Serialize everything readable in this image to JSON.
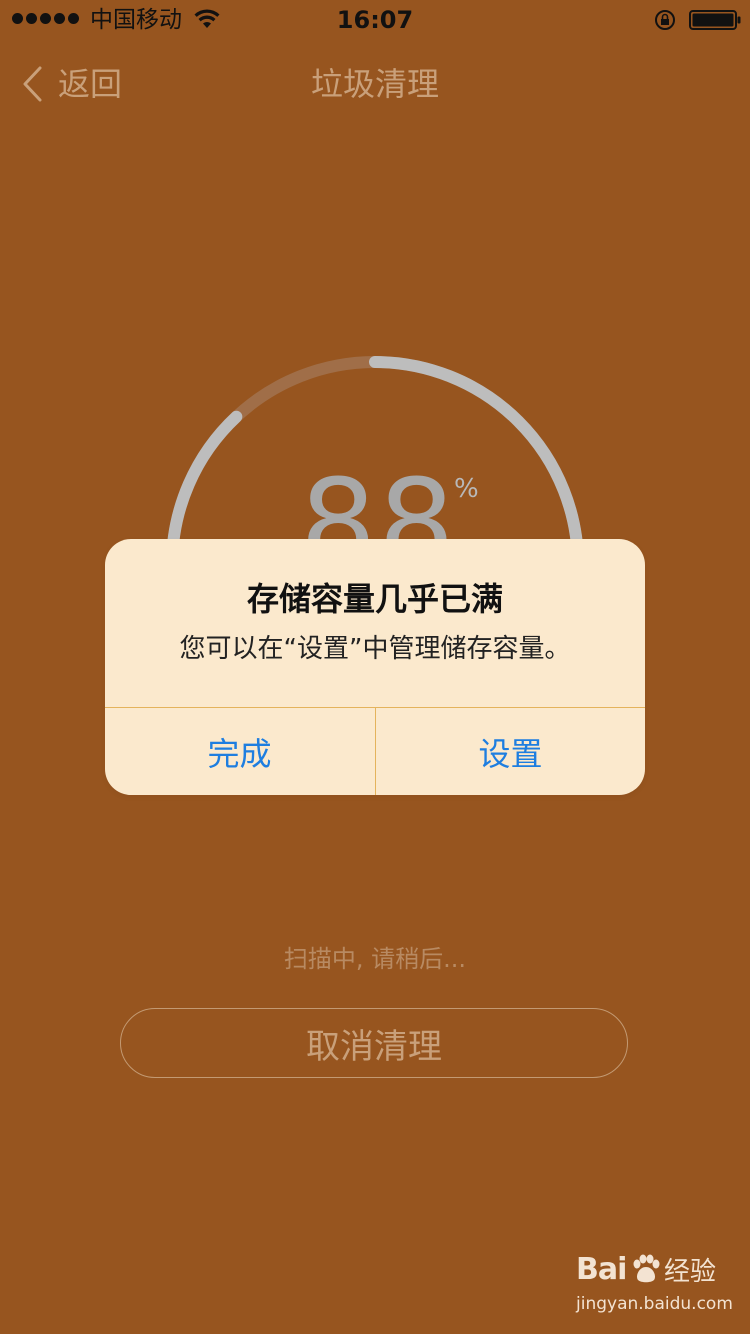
{
  "status_bar": {
    "carrier": "中国移动",
    "time": "16:07",
    "icons": [
      "signal-dots",
      "wifi-icon",
      "rotation-lock-icon",
      "battery-icon"
    ]
  },
  "nav": {
    "back_label": "返回",
    "title": "垃圾清理"
  },
  "progress": {
    "value": "88",
    "unit": "%",
    "fraction": 0.88
  },
  "alert": {
    "title": "存储容量几乎已满",
    "message": "您可以在“设置”中管理储存容量。",
    "buttons": [
      {
        "label": "完成"
      },
      {
        "label": "设置"
      }
    ]
  },
  "scan_status": "扫描中, 请稍后...",
  "cancel_label": "取消清理",
  "watermark": {
    "logo": "Bai  ",
    "brand": "经验",
    "url": "jingyan.baidu.com"
  },
  "colors": {
    "background": "#97551f",
    "alert_bg": "#fbe9cd",
    "accent_blue": "#1e7ee0",
    "muted_text": "#c9a07a"
  }
}
